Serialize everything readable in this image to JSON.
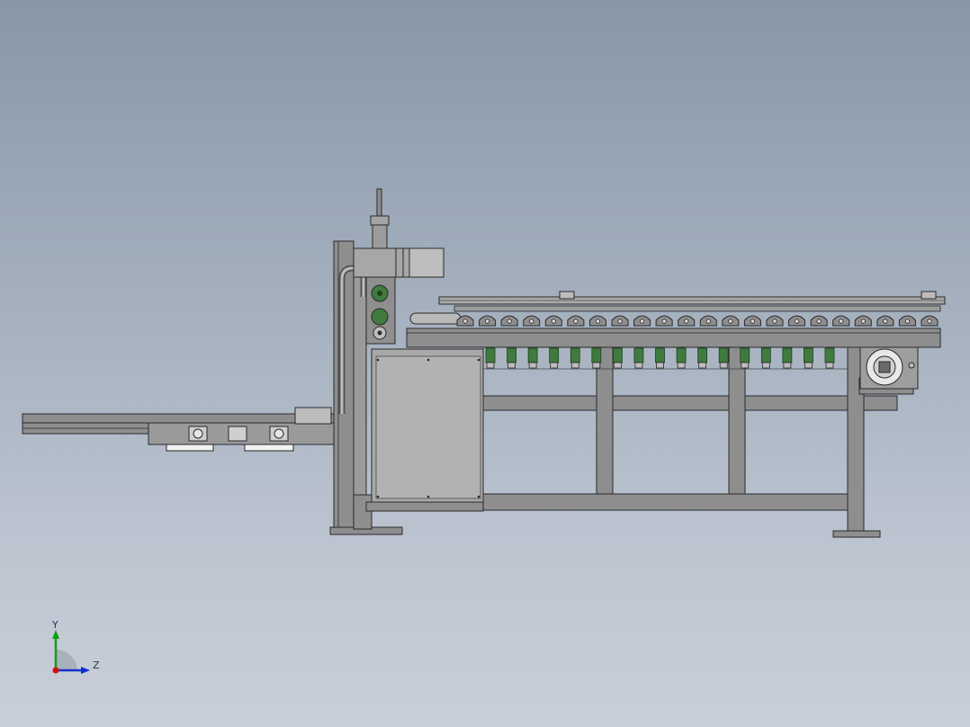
{
  "triad": {
    "y_label": "Y",
    "z_label": "Z"
  },
  "colors": {
    "background_top": "#8797a8",
    "background_bottom": "#c9cfd8",
    "frame": "#8e8e8e",
    "frame_dark": "#5a5a5a",
    "edge": "#2a2a2a",
    "panel": "#a9a9a9",
    "green_part": "#3f7a3f",
    "white_part": "#f2f2f2",
    "axis_x": "#d01010",
    "axis_y": "#10a010",
    "axis_z": "#1030d0"
  },
  "icons": {
    "triad": "coordinate-triad-icon"
  },
  "conveyor": {
    "roller_count": 22,
    "green_bracket_count": 17
  }
}
